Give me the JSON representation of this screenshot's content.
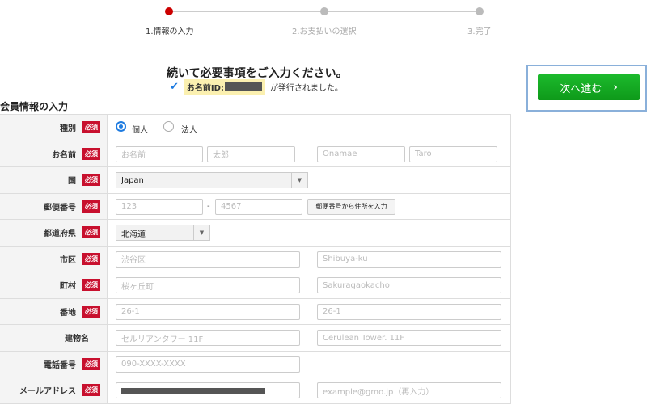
{
  "stepper": {
    "steps": [
      {
        "label": "1.情報の入力"
      },
      {
        "label": "2.お支払いの選択"
      },
      {
        "label": "3.完了"
      }
    ]
  },
  "header": {
    "title": "続いて必要事項をご入力ください。",
    "id_label": "お名前ID:",
    "issued_suffix": "が発行されました。"
  },
  "next_button": {
    "label": "次へ進む",
    "chevron": "›"
  },
  "section": {
    "title": "会員情報の入力"
  },
  "required_badge": "必須",
  "form": {
    "type": {
      "label": "種別",
      "options": [
        "個人",
        "法人"
      ],
      "selected": "個人"
    },
    "name": {
      "label": "お名前",
      "placeholders": [
        "お名前",
        "太郎",
        "Onamae",
        "Taro"
      ]
    },
    "country": {
      "label": "国",
      "value": "Japan"
    },
    "postal": {
      "label": "郵便番号",
      "placeholders": [
        "123",
        "4567"
      ],
      "separator": "-",
      "lookup_button": "郵便番号から住所を入力"
    },
    "prefecture": {
      "label": "都道府県",
      "value": "北海道"
    },
    "city": {
      "label": "市区",
      "placeholders": [
        "渋谷区",
        "Shibuya-ku"
      ]
    },
    "town": {
      "label": "町村",
      "placeholders": [
        "桜ヶ丘町",
        "Sakuragaokacho"
      ]
    },
    "block": {
      "label": "番地",
      "placeholders": [
        "26-1",
        "26-1"
      ]
    },
    "building": {
      "label": "建物名",
      "placeholders": [
        "セルリアンタワー 11F",
        "Cerulean Tower. 11F"
      ]
    },
    "phone": {
      "label": "電話番号",
      "placeholder": "090-XXXX-XXXX"
    },
    "email": {
      "label": "メールアドレス",
      "confirm_placeholder": "example@gmo.jp（再入力）"
    }
  },
  "colors": {
    "accent": "#1e7be0",
    "required": "#c8102e",
    "next": "#14a822",
    "active_step": "#cc0000"
  }
}
